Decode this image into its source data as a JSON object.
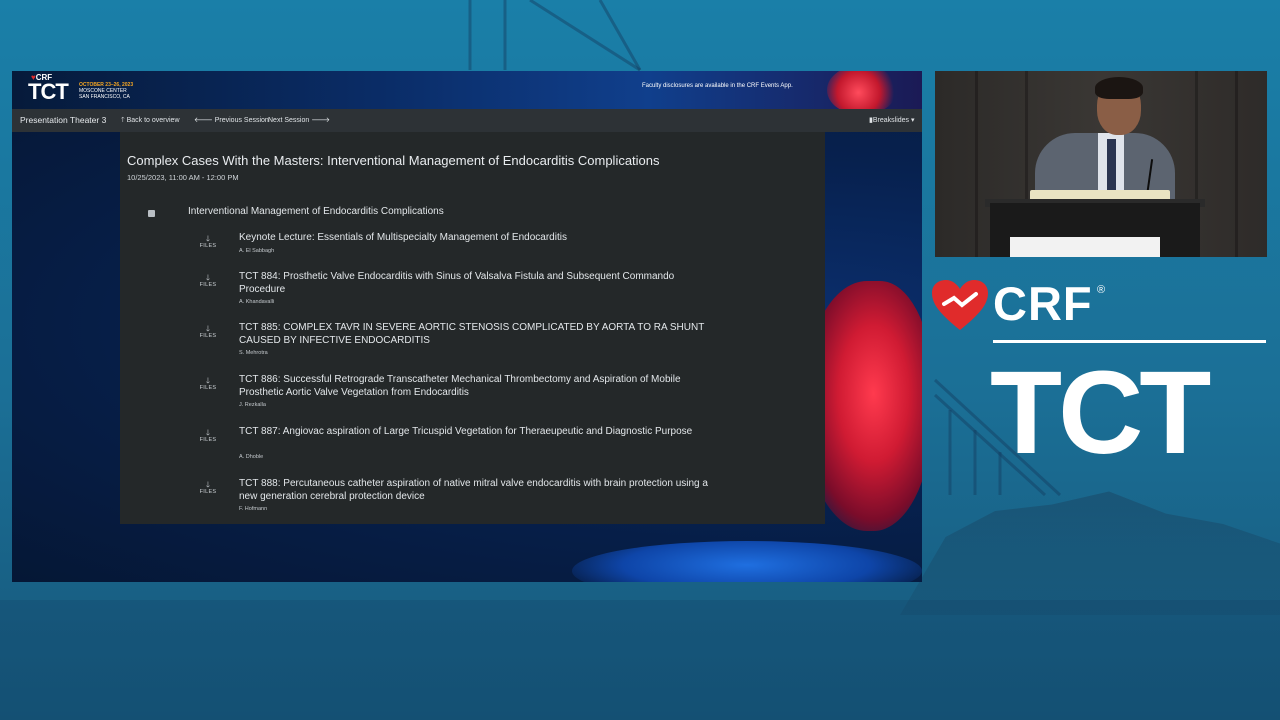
{
  "banner": {
    "brand_small": "CRF",
    "event_logo": "TCT",
    "event_dates": "OCTOBER 23–26, 2023",
    "event_venue": "MOSCONE CENTER",
    "event_city": "SAN FRANCISCO, CA",
    "disclosure_text": "Faculty disclosures are available in the CRF Events App."
  },
  "navbar": {
    "title": "Presentation Theater 3",
    "back_label": "Back to overview",
    "prev_label": "Previous Session",
    "next_label": "Next Session",
    "breakslides_label": "Breakslides"
  },
  "session": {
    "title": "Complex Cases With the Masters: Interventional Management of Endocarditis Complications",
    "datetime": "10/25/2023, 11:00 AM - 12:00 PM",
    "group_title": "Interventional Management of Endocarditis Complications",
    "files_label": "FILES",
    "talks": [
      {
        "title": "Keynote Lecture: Essentials of Multispecialty Management of Endocarditis",
        "author": "A. El Sabbagh"
      },
      {
        "title": "TCT 884: Prosthetic Valve Endocarditis with Sinus of Valsalva Fistula and Subsequent Commando Procedure",
        "author": "A. Khandavalli"
      },
      {
        "title": "TCT 885: COMPLEX TAVR IN SEVERE AORTIC STENOSIS COMPLICATED BY AORTA TO RA SHUNT CAUSED BY INFECTIVE ENDOCARDITIS",
        "author": "S. Mehrotra"
      },
      {
        "title": "TCT 886: Successful Retrograde Transcatheter Mechanical Thrombectomy and Aspiration of Mobile Prosthetic Aortic Valve Vegetation from Endocarditis",
        "author": "J. Rezkalla"
      },
      {
        "title": "TCT 887: Angiovac aspiration of Large Tricuspid Vegetation for Theraeupeutic and Diagnostic Purpose",
        "author": "A. Dhoble"
      },
      {
        "title": "TCT 888: Percutaneous catheter aspiration of native mitral valve endocarditis with brain protection using a new generation cerebral protection device",
        "author": "F. Hofmann"
      }
    ]
  },
  "branding": {
    "crf": "CRF",
    "registered": "®",
    "tct": "TCT"
  },
  "colors": {
    "background": "#1b6f96",
    "panel": "#242829",
    "navbar": "#2d3236",
    "accent_red": "#e02b2b",
    "date_orange": "#f5a623"
  }
}
